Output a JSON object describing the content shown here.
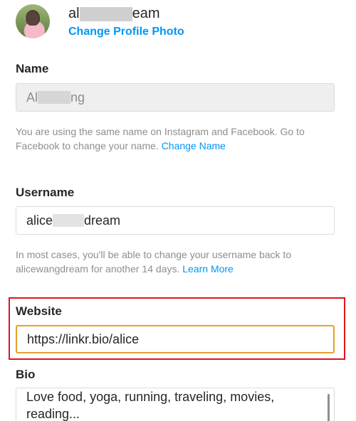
{
  "profile": {
    "username_visible_start": "al",
    "username_visible_end": "eam",
    "change_photo_label": "Change Profile Photo"
  },
  "name": {
    "label": "Name",
    "value_start": "Al",
    "value_end": "ng",
    "help_text": "You are using the same name on Instagram and Facebook. Go to Facebook to change your name.",
    "help_link": "Change Name"
  },
  "username": {
    "label": "Username",
    "value_start": "alice",
    "value_end": "dream",
    "help_text": "In most cases, you'll be able to change your username back to alicewangdream for another 14 days.",
    "help_link": "Learn More"
  },
  "website": {
    "label": "Website",
    "value": "https://linkr.bio/alice"
  },
  "bio": {
    "label": "Bio",
    "value": "Love food, yoga, running, traveling, movies, reading..."
  },
  "colors": {
    "link": "#0095f6",
    "highlight_box": "#e0151b",
    "focus_border": "#e0a32e"
  }
}
